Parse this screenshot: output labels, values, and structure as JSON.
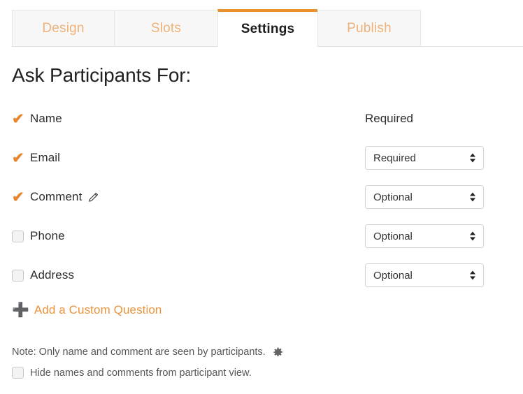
{
  "tabs": [
    {
      "label": "Design",
      "active": false
    },
    {
      "label": "Slots",
      "active": false
    },
    {
      "label": "Settings",
      "active": true
    },
    {
      "label": "Publish",
      "active": false
    }
  ],
  "page": {
    "title": "Ask Participants For:"
  },
  "fields": [
    {
      "label": "Name",
      "checked": true,
      "control": "text",
      "value": "Required",
      "has_edit_icon": false
    },
    {
      "label": "Email",
      "checked": true,
      "control": "select",
      "value": "Required",
      "has_edit_icon": false
    },
    {
      "label": "Comment",
      "checked": true,
      "control": "select",
      "value": "Optional",
      "has_edit_icon": true
    },
    {
      "label": "Phone",
      "checked": false,
      "control": "select",
      "value": "Optional",
      "has_edit_icon": false
    },
    {
      "label": "Address",
      "checked": false,
      "control": "select",
      "value": "Optional",
      "has_edit_icon": false
    }
  ],
  "select_options": [
    "Required",
    "Optional"
  ],
  "add_custom_question": {
    "icon": "plus-icon",
    "label": "Add a Custom Question"
  },
  "note": {
    "text": "Note: Only name and comment are seen by participants.",
    "icon": "gear-icon"
  },
  "hide_option": {
    "label": "Hide names and comments from participant view.",
    "checked": false
  },
  "colors": {
    "accent_orange": "#e8912e",
    "tab_inactive_text": "#efb279",
    "link_orange": "#e8943c",
    "check_orange": "#e8862c"
  },
  "icons": {
    "check": "✔",
    "plus": "➕"
  }
}
